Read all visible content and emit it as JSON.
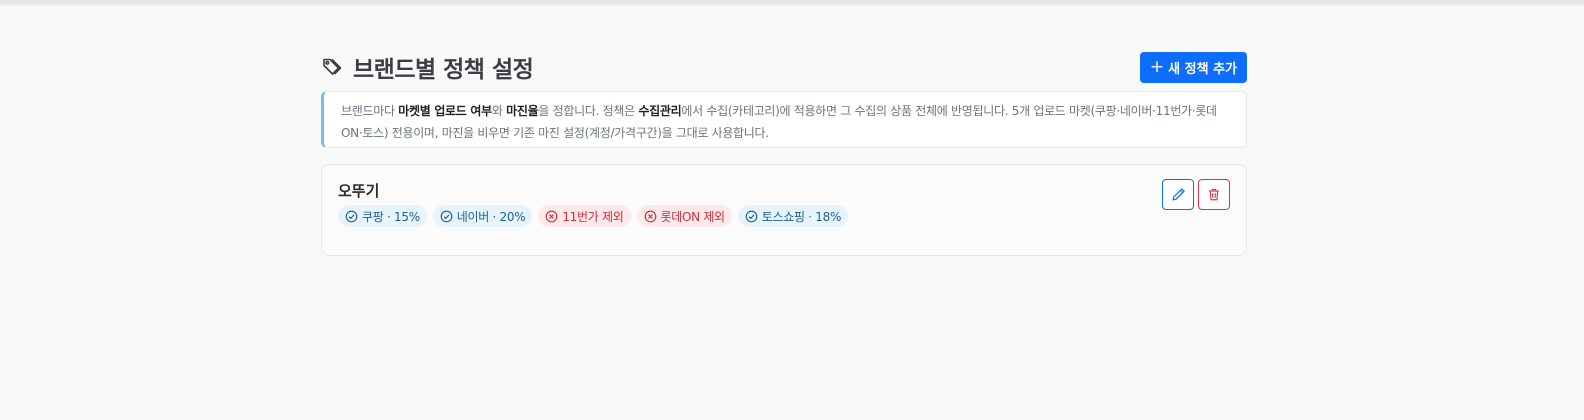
{
  "header": {
    "title": "브랜드별 정책 설정",
    "title_icon": "tags-icon",
    "add_button_label": "새 정책 추가",
    "add_button_icon": "plus-icon",
    "accent_color": "#0d6efd"
  },
  "notice": {
    "p1": "브랜드마다 ",
    "b1": "마켓별 업로드 여부",
    "p2": "와 ",
    "b2": "마진율",
    "p3": "을 정합니다. 정책은 ",
    "b3": "수집관리",
    "p4": "에서 수집(카테고리)에 적용하면 그 수집의 상품 전체에 반영됩니다. 5개 업로드 마켓(쿠팡·네이버·11번가·롯데ON·토스) 전용이며, 마진을 비우면 기존 마진 설정(계정/가격구간)을 그대로 사용합니다."
  },
  "policies": [
    {
      "brand": "오뚜기",
      "badges": [
        {
          "label": "쿠팡 · 15%",
          "status": "on",
          "icon": "check-circle-icon"
        },
        {
          "label": "네이버 · 20%",
          "status": "on",
          "icon": "check-circle-icon"
        },
        {
          "label": "11번가 제외",
          "status": "off",
          "icon": "x-circle-icon"
        },
        {
          "label": "롯데ON 제외",
          "status": "off",
          "icon": "x-circle-icon"
        },
        {
          "label": "토스쇼핑 · 18%",
          "status": "on",
          "icon": "check-circle-icon"
        }
      ],
      "edit_icon": "pencil-icon",
      "delete_icon": "trash-icon"
    }
  ],
  "colors": {
    "on_bg": "#e7f3fd",
    "on_text": "#1c5f98",
    "off_bg": "#fde8ea",
    "off_text": "#c9303e",
    "delete": "#dc3545"
  }
}
